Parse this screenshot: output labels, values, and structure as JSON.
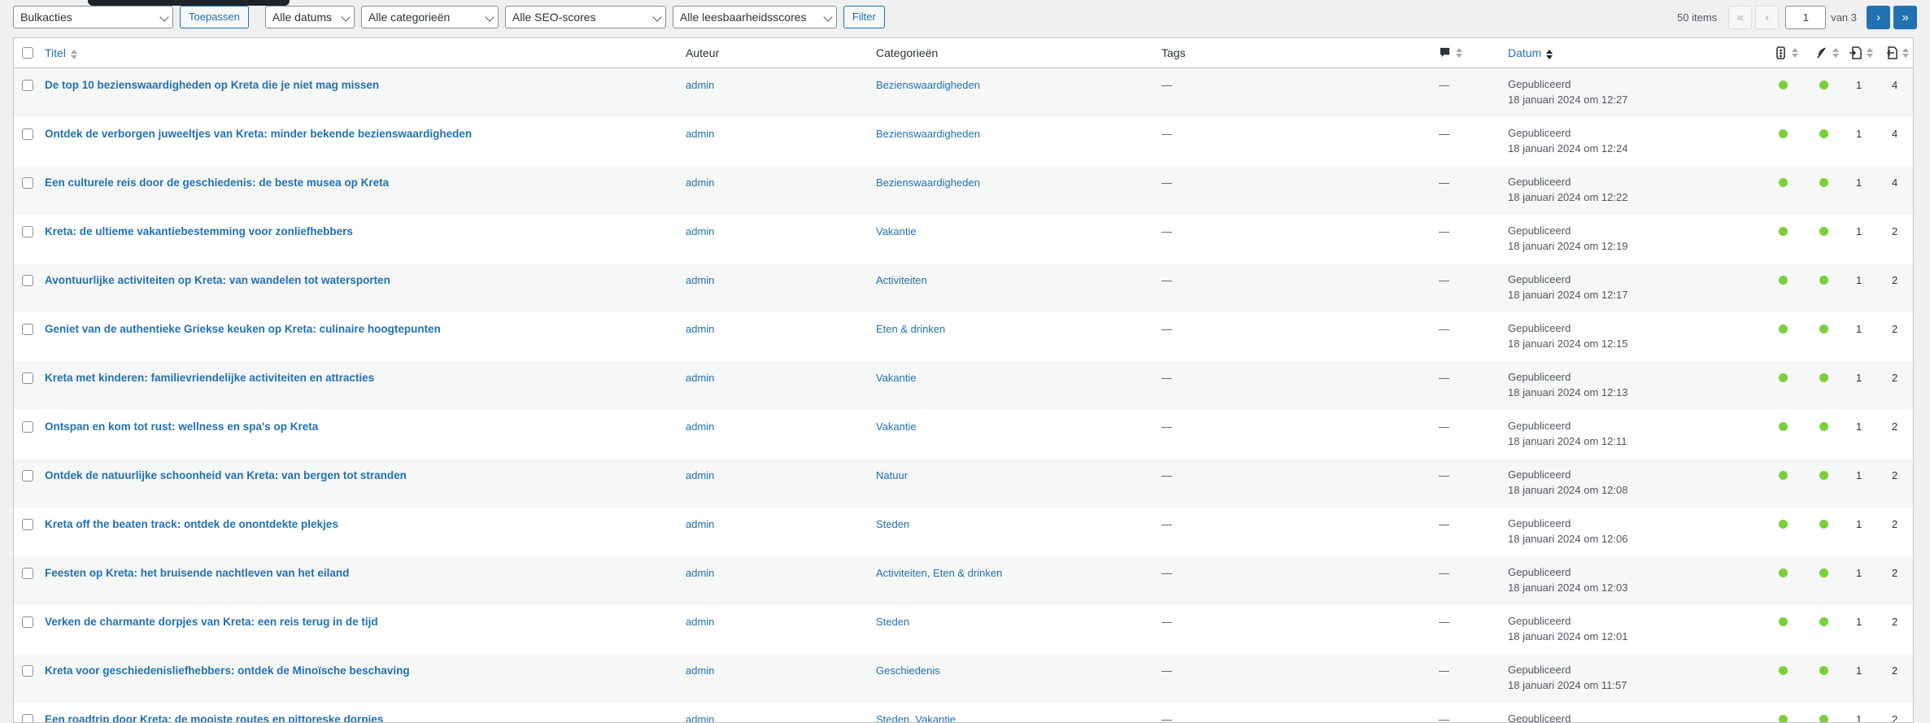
{
  "toolbar": {
    "bulk_actions": "Bulkacties",
    "apply": "Toepassen",
    "dates": "Alle datums",
    "categories": "Alle categorieën",
    "seo": "Alle SEO-scores",
    "readability": "Alle leesbaarheidsscores",
    "filter": "Filter"
  },
  "pagination": {
    "items": "50 items",
    "first": "«",
    "prev": "‹",
    "current": "1",
    "of": "van 3",
    "next": "›",
    "last": "»"
  },
  "columns": {
    "title": "Titel",
    "author": "Auteur",
    "categories": "Categorieën",
    "tags": "Tags",
    "comments_icon": "comment-icon",
    "date": "Datum",
    "seo_icon": "seo-score-icon",
    "readability_icon": "readability-icon",
    "outgoing_links_icon": "outgoing-links-icon",
    "incoming_links_icon": "incoming-links-icon"
  },
  "colors": {
    "link": "#2271b1",
    "good_score": "#7ad03a"
  },
  "rows": [
    {
      "title": "De top 10 bezienswaardigheden op Kreta die je niet mag missen",
      "author": "admin",
      "categories": "Bezienswaardigheden",
      "tags": "—",
      "comments": "—",
      "status": "Gepubliceerd",
      "date": "18 januari 2024 om 12:27",
      "outgoing": "1",
      "incoming": "4"
    },
    {
      "title": "Ontdek de verborgen juweeltjes van Kreta: minder bekende bezienswaardigheden",
      "author": "admin",
      "categories": "Bezienswaardigheden",
      "tags": "—",
      "comments": "—",
      "status": "Gepubliceerd",
      "date": "18 januari 2024 om 12:24",
      "outgoing": "1",
      "incoming": "4"
    },
    {
      "title": "Een culturele reis door de geschiedenis: de beste musea op Kreta",
      "author": "admin",
      "categories": "Bezienswaardigheden",
      "tags": "—",
      "comments": "—",
      "status": "Gepubliceerd",
      "date": "18 januari 2024 om 12:22",
      "outgoing": "1",
      "incoming": "4"
    },
    {
      "title": "Kreta: de ultieme vakantiebestemming voor zonliefhebbers",
      "author": "admin",
      "categories": "Vakantie",
      "tags": "—",
      "comments": "—",
      "status": "Gepubliceerd",
      "date": "18 januari 2024 om 12:19",
      "outgoing": "1",
      "incoming": "2"
    },
    {
      "title": "Avontuurlijke activiteiten op Kreta: van wandelen tot watersporten",
      "author": "admin",
      "categories": "Activiteiten",
      "tags": "—",
      "comments": "—",
      "status": "Gepubliceerd",
      "date": "18 januari 2024 om 12:17",
      "outgoing": "1",
      "incoming": "2"
    },
    {
      "title": "Geniet van de authentieke Griekse keuken op Kreta: culinaire hoogtepunten",
      "author": "admin",
      "categories": "Eten & drinken",
      "tags": "—",
      "comments": "—",
      "status": "Gepubliceerd",
      "date": "18 januari 2024 om 12:15",
      "outgoing": "1",
      "incoming": "2"
    },
    {
      "title": "Kreta met kinderen: familievriendelijke activiteiten en attracties",
      "author": "admin",
      "categories": "Vakantie",
      "tags": "—",
      "comments": "—",
      "status": "Gepubliceerd",
      "date": "18 januari 2024 om 12:13",
      "outgoing": "1",
      "incoming": "2"
    },
    {
      "title": "Ontspan en kom tot rust: wellness en spa's op Kreta",
      "author": "admin",
      "categories": "Vakantie",
      "tags": "—",
      "comments": "—",
      "status": "Gepubliceerd",
      "date": "18 januari 2024 om 12:11",
      "outgoing": "1",
      "incoming": "2"
    },
    {
      "title": "Ontdek de natuurlijke schoonheid van Kreta: van bergen tot stranden",
      "author": "admin",
      "categories": "Natuur",
      "tags": "—",
      "comments": "—",
      "status": "Gepubliceerd",
      "date": "18 januari 2024 om 12:08",
      "outgoing": "1",
      "incoming": "2"
    },
    {
      "title": "Kreta off the beaten track: ontdek de onontdekte plekjes",
      "author": "admin",
      "categories": "Steden",
      "tags": "—",
      "comments": "—",
      "status": "Gepubliceerd",
      "date": "18 januari 2024 om 12:06",
      "outgoing": "1",
      "incoming": "2"
    },
    {
      "title": "Feesten op Kreta: het bruisende nachtleven van het eiland",
      "author": "admin",
      "categories": "Activiteiten, Eten & drinken",
      "tags": "—",
      "comments": "—",
      "status": "Gepubliceerd",
      "date": "18 januari 2024 om 12:03",
      "outgoing": "1",
      "incoming": "2"
    },
    {
      "title": "Verken de charmante dorpjes van Kreta: een reis terug in de tijd",
      "author": "admin",
      "categories": "Steden",
      "tags": "—",
      "comments": "—",
      "status": "Gepubliceerd",
      "date": "18 januari 2024 om 12:01",
      "outgoing": "1",
      "incoming": "2"
    },
    {
      "title": "Kreta voor geschiedenisliefhebbers: ontdek de Minoïsche beschaving",
      "author": "admin",
      "categories": "Geschiedenis",
      "tags": "—",
      "comments": "—",
      "status": "Gepubliceerd",
      "date": "18 januari 2024 om 11:57",
      "outgoing": "1",
      "incoming": "2"
    },
    {
      "title": "Een roadtrip door Kreta: de mooiste routes en pittoreske dorpjes",
      "author": "admin",
      "categories": "Steden, Vakantie",
      "tags": "—",
      "comments": "—",
      "status": "Gepubliceerd",
      "date": "",
      "outgoing": "1",
      "incoming": "2"
    }
  ]
}
